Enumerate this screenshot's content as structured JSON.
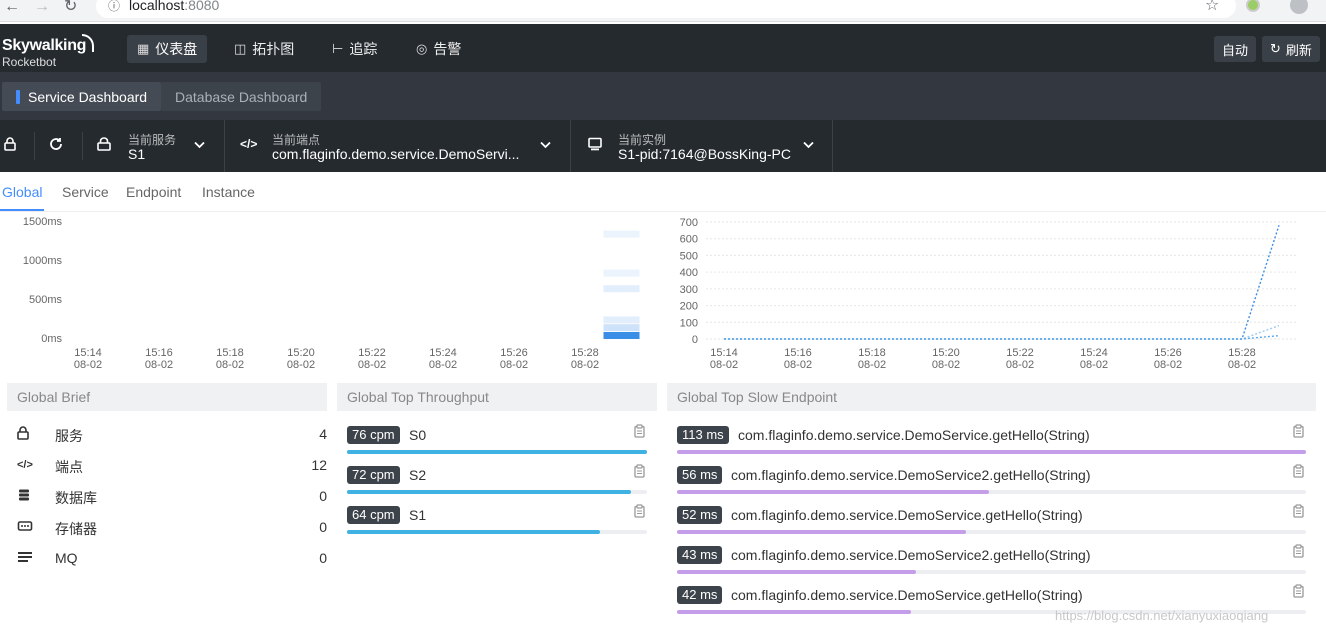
{
  "browser": {
    "back": "←",
    "forward": "→",
    "reload": "↻",
    "info": "ⓘ",
    "url_host": "localhost",
    "url_port": ":8080",
    "star": "☆"
  },
  "header": {
    "logo": "Skywalking",
    "logo_sub": "Rocketbot",
    "nav": [
      {
        "icon": "▦",
        "label": "仪表盘",
        "active": true
      },
      {
        "icon": "◫",
        "label": "拓扑图",
        "active": false
      },
      {
        "icon": "⊢",
        "label": "追踪",
        "active": false
      },
      {
        "icon": "◎",
        "label": "告警",
        "active": false
      }
    ],
    "auto_label": "自动",
    "refresh_icon": "↻",
    "refresh_label": "刷新"
  },
  "dashboards": {
    "tabs": [
      "Service Dashboard",
      "Database Dashboard"
    ]
  },
  "selectors": {
    "service": {
      "label": "当前服务",
      "value": "S1"
    },
    "endpoint": {
      "label": "当前端点",
      "value": "com.flaginfo.demo.service.DemoServi..."
    },
    "instance": {
      "label": "当前实例",
      "value": "S1-pid:7164@BossKing-PC"
    },
    "chevron": "⌄"
  },
  "sub_tabs": [
    "Global",
    "Service",
    "Endpoint",
    "Instance"
  ],
  "chart_data": [
    {
      "type": "heatmap",
      "y_ticks": [
        "1500ms",
        "1000ms",
        "500ms",
        "0ms"
      ],
      "x_ticks": [
        "15:14\n08-02",
        "15:16\n08-02",
        "15:18\n08-02",
        "15:20\n08-02",
        "15:22\n08-02",
        "15:24\n08-02",
        "15:26\n08-02",
        "15:28\n08-02"
      ],
      "ylim": [
        0,
        1500
      ],
      "cells": [
        {
          "x": "15:29",
          "y": 0,
          "intensity": 1.0
        },
        {
          "x": "15:29",
          "y": 100,
          "intensity": 0.25
        },
        {
          "x": "15:29",
          "y": 200,
          "intensity": 0.15
        },
        {
          "x": "15:29",
          "y": 600,
          "intensity": 0.15
        },
        {
          "x": "15:29",
          "y": 800,
          "intensity": 0.1
        },
        {
          "x": "15:29",
          "y": 1300,
          "intensity": 0.1
        }
      ],
      "color": "#3a8ee6"
    },
    {
      "type": "line",
      "y_ticks": [
        "700",
        "600",
        "500",
        "400",
        "300",
        "200",
        "100",
        "0"
      ],
      "x_ticks": [
        "15:14\n08-02",
        "15:16\n08-02",
        "15:18\n08-02",
        "15:20\n08-02",
        "15:22\n08-02",
        "15:24\n08-02",
        "15:26\n08-02",
        "15:28\n08-02"
      ],
      "ylim": [
        0,
        700
      ],
      "series": [
        {
          "values_x": [
            "15:14",
            "15:28",
            "15:29"
          ],
          "values": [
            0,
            0,
            680
          ],
          "color": "#3a8ee6",
          "style": "dotted"
        },
        {
          "values_x": [
            "15:14",
            "15:28",
            "15:29"
          ],
          "values": [
            0,
            0,
            80
          ],
          "color": "#9ecbf0",
          "style": "dotted"
        },
        {
          "values_x": [
            "15:14",
            "15:28",
            "15:29"
          ],
          "values": [
            0,
            0,
            20
          ],
          "color": "#5aa8ea",
          "style": "dotted"
        }
      ]
    }
  ],
  "brief": {
    "title": "Global Brief",
    "items": [
      {
        "icon": "🔒",
        "label": "服务",
        "value": "4"
      },
      {
        "icon": "‹/›",
        "label": "端点",
        "value": "12"
      },
      {
        "icon": "☰",
        "label": "数据库",
        "value": "0"
      },
      {
        "icon": "▭",
        "label": "存储器",
        "value": "0"
      },
      {
        "icon": "≡",
        "label": "MQ",
        "value": "0"
      }
    ]
  },
  "throughput": {
    "title": "Global Top Throughput",
    "clip_icon": "📋",
    "items": [
      {
        "badge": "76 cpm",
        "label": "S0",
        "value": 76
      },
      {
        "badge": "72 cpm",
        "label": "S2",
        "value": 72
      },
      {
        "badge": "64 cpm",
        "label": "S1",
        "value": 64
      }
    ],
    "max": 76
  },
  "slow": {
    "title": "Global Top Slow Endpoint",
    "clip_icon": "📋",
    "items": [
      {
        "badge": "113 ms",
        "label": "com.flaginfo.demo.service.DemoService.getHello(String)",
        "value": 113
      },
      {
        "badge": "56 ms",
        "label": "com.flaginfo.demo.service.DemoService2.getHello(String)",
        "value": 56
      },
      {
        "badge": "52 ms",
        "label": "com.flaginfo.demo.service.DemoService.getHello(String)",
        "value": 52
      },
      {
        "badge": "43 ms",
        "label": "com.flaginfo.demo.service.DemoService2.getHello(String)",
        "value": 43
      },
      {
        "badge": "42 ms",
        "label": "com.flaginfo.demo.service.DemoService.getHello(String)",
        "value": 42
      }
    ],
    "max": 113
  },
  "watermark": "https://blog.csdn.net/xianyuxiaoqiang"
}
